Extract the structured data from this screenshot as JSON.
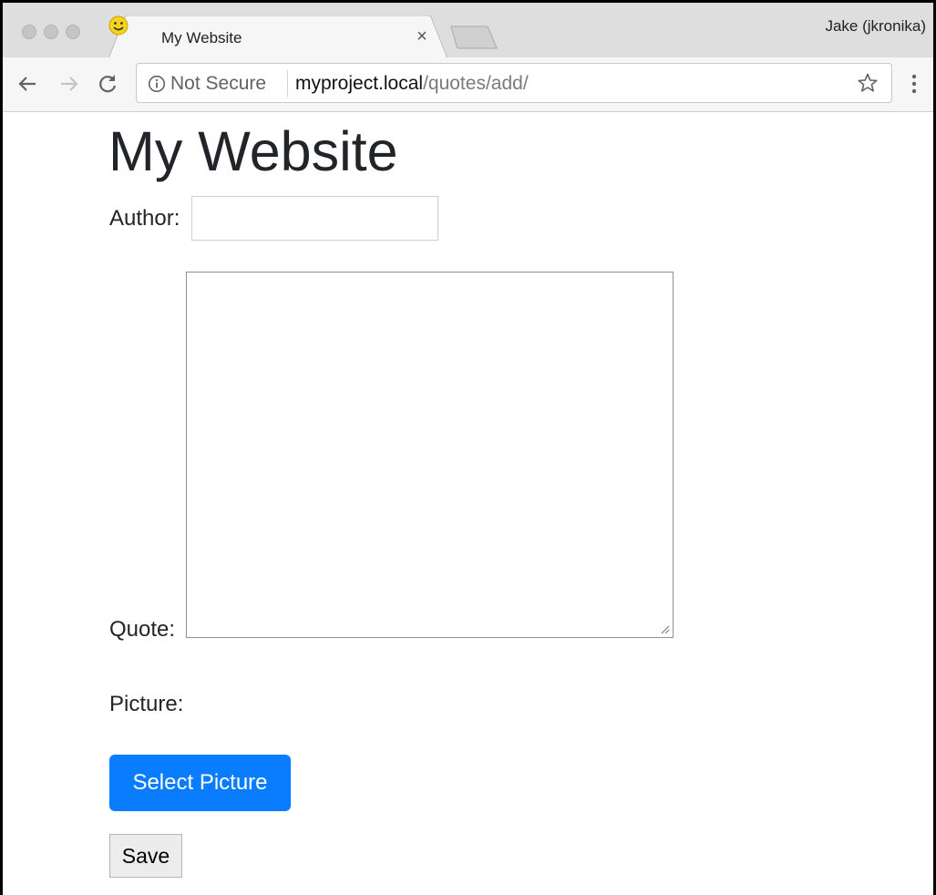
{
  "browser": {
    "tab": {
      "title": "My Website",
      "close_glyph": "×",
      "favicon": "smiley-icon"
    },
    "profile_name": "Jake (jkronika)",
    "omnibox": {
      "security_label": "Not Secure",
      "url_host": "myproject.local",
      "url_path": "/quotes/add/"
    },
    "icons": {
      "back": "back-arrow-icon",
      "forward": "forward-arrow-icon",
      "reload": "reload-icon",
      "info": "info-icon",
      "bookmark": "star-icon",
      "menu": "kebab-menu-icon"
    }
  },
  "page": {
    "title": "My Website",
    "form": {
      "author_label": "Author:",
      "author_value": "",
      "quote_label": "Quote:",
      "quote_value": "",
      "picture_label": "Picture:",
      "select_picture_label": "Select Picture",
      "save_label": "Save"
    }
  },
  "colors": {
    "primary_button": "#0a7cff",
    "heading_text": "#212529",
    "tab_strip": "#dedede"
  }
}
